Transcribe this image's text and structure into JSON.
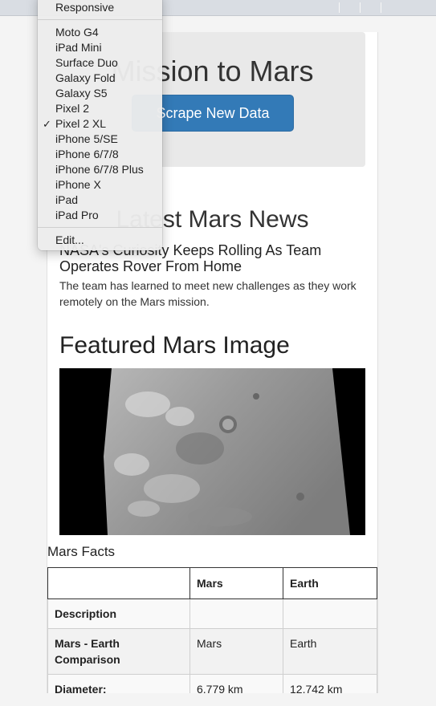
{
  "jumbotron": {
    "title": "Mission to Mars",
    "button_label": "Scrape New Data"
  },
  "news": {
    "heading": "Latest Mars News",
    "title": "NASA's Curiosity Keeps Rolling As Team Operates Rover From Home",
    "paragraph": "The team has learned to meet new challenges as they work remotely on the Mars mission."
  },
  "featured": {
    "heading": "Featured Mars Image"
  },
  "facts": {
    "heading": "Mars Facts",
    "columns": [
      "",
      "Mars",
      "Earth"
    ],
    "rows": [
      [
        "Description",
        "",
        ""
      ],
      [
        "Mars - Earth Comparison",
        "Mars",
        "Earth"
      ],
      [
        "Diameter:",
        "6,779 km",
        "12,742 km"
      ]
    ]
  },
  "device_menu": {
    "items": [
      {
        "label": "Responsive",
        "checked": false
      },
      {
        "label": "Moto G4",
        "checked": false
      },
      {
        "label": "iPad Mini",
        "checked": false
      },
      {
        "label": "Surface Duo",
        "checked": false
      },
      {
        "label": "Galaxy Fold",
        "checked": false
      },
      {
        "label": "Galaxy S5",
        "checked": false
      },
      {
        "label": "Pixel 2",
        "checked": false
      },
      {
        "label": "Pixel 2 XL",
        "checked": true
      },
      {
        "label": "iPhone 5/SE",
        "checked": false
      },
      {
        "label": "iPhone 6/7/8",
        "checked": false
      },
      {
        "label": "iPhone 6/7/8 Plus",
        "checked": false
      },
      {
        "label": "iPhone X",
        "checked": false
      },
      {
        "label": "iPad",
        "checked": false
      },
      {
        "label": "iPad Pro",
        "checked": false
      },
      {
        "label": "Edit...",
        "checked": false
      }
    ],
    "check_mark": "✓"
  },
  "colors": {
    "button_primary": "#337ab7",
    "jumbotron_bg": "#e9e9e9"
  }
}
